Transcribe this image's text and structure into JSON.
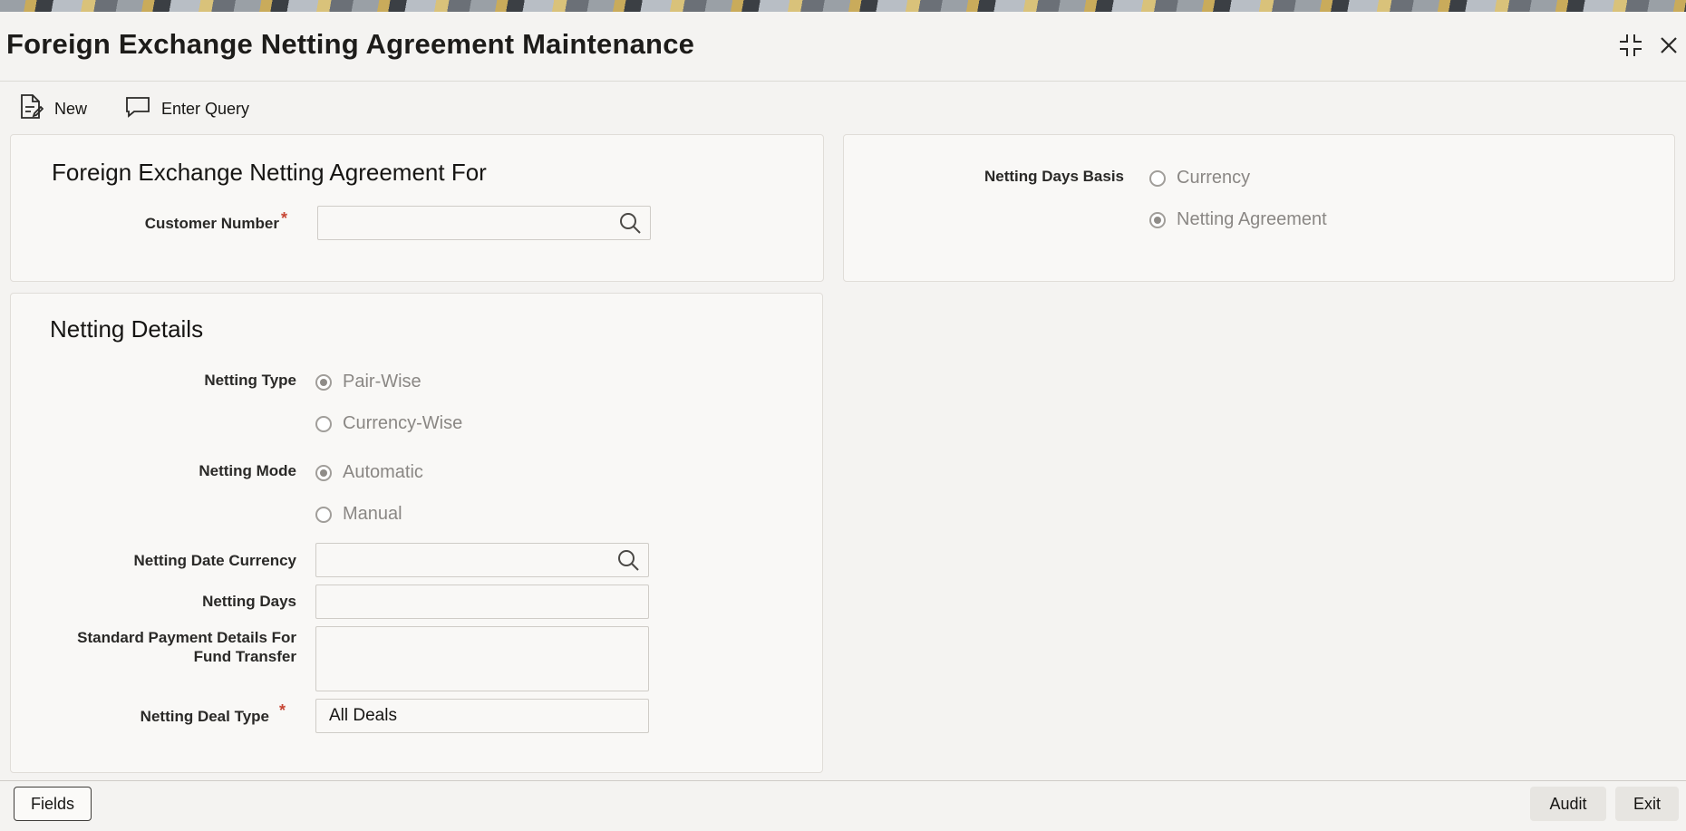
{
  "window": {
    "title": "Foreign Exchange Netting Agreement Maintenance",
    "icons": [
      "collapse-icon",
      "close-icon"
    ]
  },
  "toolbar": {
    "new_label": "New",
    "enter_query_label": "Enter Query"
  },
  "agreement_for": {
    "title": "Foreign Exchange Netting Agreement For",
    "customer_number_label": "Customer Number",
    "customer_number_value": "",
    "required_mark": "*"
  },
  "netting_days_basis": {
    "label": "Netting Days Basis",
    "options": [
      {
        "label": "Currency",
        "selected": false
      },
      {
        "label": "Netting Agreement",
        "selected": true
      }
    ]
  },
  "netting_details": {
    "title": "Netting Details",
    "netting_type_label": "Netting Type",
    "netting_type_options": [
      {
        "label": "Pair-Wise",
        "selected": true
      },
      {
        "label": "Currency-Wise",
        "selected": false
      }
    ],
    "netting_mode_label": "Netting Mode",
    "netting_mode_options": [
      {
        "label": "Automatic",
        "selected": true
      },
      {
        "label": "Manual",
        "selected": false
      }
    ],
    "netting_date_currency_label": "Netting Date Currency",
    "netting_date_currency_value": "",
    "netting_days_label": "Netting Days",
    "netting_days_value": "",
    "payment_details_label_line1": "Standard Payment Details For",
    "payment_details_label_line2": "Fund Transfer",
    "payment_details_value": "",
    "deal_type_label": "Netting Deal Type",
    "deal_type_value": "All Deals",
    "required_mark": "*"
  },
  "footer": {
    "fields_label": "Fields",
    "audit_label": "Audit",
    "exit_label": "Exit"
  },
  "colors": {
    "required": "#c74634",
    "radio_disabled_text": "#8a8784",
    "panel_bg": "#f9f8f6"
  }
}
